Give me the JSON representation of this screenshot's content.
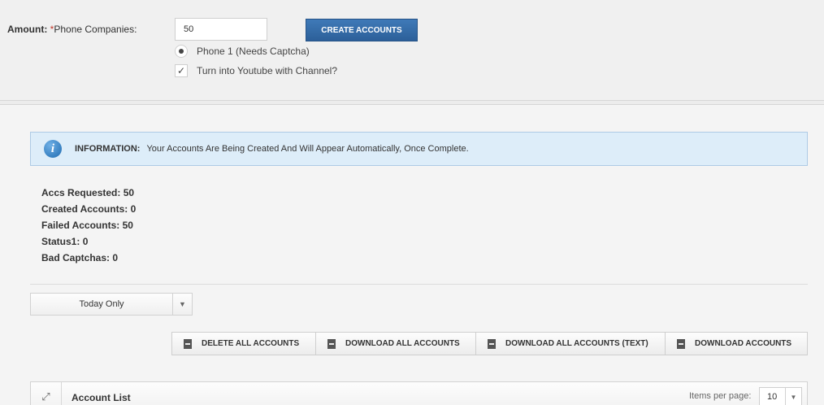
{
  "form": {
    "amount_label": "Amount:",
    "required_mark": "*",
    "field_label": "Phone Companies:",
    "amount_value": "50",
    "create_button": "CREATE ACCOUNTS",
    "radio_option": "Phone 1 (Needs Captcha)",
    "checkbox_option": "Turn into Youtube with Channel?"
  },
  "info": {
    "icon": "info-icon",
    "title": "INFORMATION:",
    "message": "Your Accounts Are Being Created And Will Appear Automatically, Once Complete."
  },
  "stats": [
    {
      "label": "Accs Requested:",
      "value": "50"
    },
    {
      "label": "Created Accounts:",
      "value": "0"
    },
    {
      "label": "Failed Accounts:",
      "value": "50"
    },
    {
      "label": "Status1:",
      "value": "0"
    },
    {
      "label": "Bad Captchas:",
      "value": "0"
    }
  ],
  "filter": {
    "selected": "Today Only"
  },
  "actions": {
    "delete_all": "DELETE ALL ACCOUNTS",
    "download_all": "DOWNLOAD ALL ACCOUNTS",
    "download_all_text": "DOWNLOAD ALL ACCOUNTS (TEXT)",
    "download": "DOWNLOAD ACCOUNTS"
  },
  "account_list": {
    "title": "Account List",
    "items_per_page_label": "Items per page:",
    "items_per_page_value": "10"
  },
  "colors": {
    "primary_button": "#2c5f99",
    "info_background": "#ddedf9"
  }
}
